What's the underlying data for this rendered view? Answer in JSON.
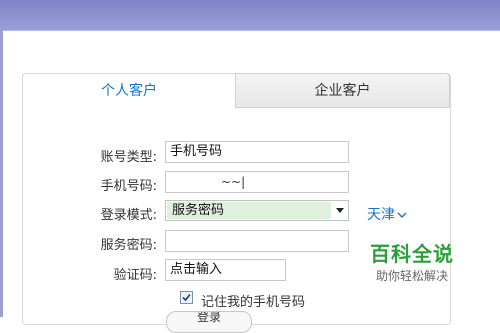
{
  "tabs": {
    "personal": "个人客户",
    "enterprise": "企业客户"
  },
  "form": {
    "account_type_label": "账号类型:",
    "account_type_value": "手机号码",
    "phone_label": "手机号码:",
    "phone_value": "~~|",
    "login_mode_label": "登录模式:",
    "login_mode_value": "服务密码",
    "service_password_label": "服务密码:",
    "captcha_label": "验证码:",
    "captcha_value": "点击输入",
    "remember_label": "记住我的手机号码",
    "remember_checked": true,
    "login_button": "登录"
  },
  "region": {
    "city": "天津"
  },
  "watermark": {
    "title": "百科全说",
    "subtitle": "助你轻松解决"
  },
  "colors": {
    "accent": "#1a73c7",
    "select_fill": "#dff0df",
    "watermark_green": "#2e9e3b",
    "header_band": "#8a8ecf"
  }
}
